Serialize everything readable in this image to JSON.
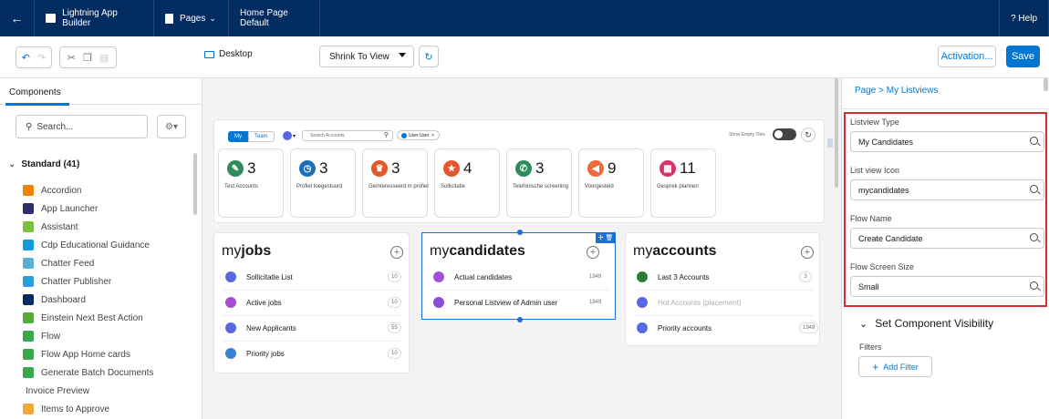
{
  "topbar": {
    "back": "←",
    "app_name": "Lightning App Builder",
    "pages_menu": "Pages",
    "page_name": "Home Page Default",
    "help": "? Help"
  },
  "toolbar": {
    "device": "Desktop",
    "view_mode": "Shrink To View",
    "activation": "Activation...",
    "save": "Save"
  },
  "left_panel": {
    "tab": "Components",
    "search_placeholder": "Search...",
    "section": "Standard (41)",
    "items": [
      {
        "label": "Accordion",
        "color": "#f38303"
      },
      {
        "label": "App Launcher",
        "color": "#2e2e6b"
      },
      {
        "label": "Assistant",
        "color": "#7fbf3f"
      },
      {
        "label": "Cdp Educational Guidance",
        "color": "#0d9dda"
      },
      {
        "label": "Chatter Feed",
        "color": "#5ab0d2"
      },
      {
        "label": "Chatter Publisher",
        "color": "#2d9ddc"
      },
      {
        "label": "Dashboard",
        "color": "#032d60"
      },
      {
        "label": "Einstein Next Best Action",
        "color": "#58a935"
      },
      {
        "label": "Flow",
        "color": "#3ca64a"
      },
      {
        "label": "Flow App Home cards",
        "color": "#3ca64a"
      },
      {
        "label": "Generate Batch Documents",
        "color": "#3ca64a"
      },
      {
        "label": "Invoice Preview",
        "color": ""
      },
      {
        "label": "Items to Approve",
        "color": "#f2a93b"
      }
    ]
  },
  "canvas": {
    "filter_bar": {
      "my": "My",
      "team": "Team",
      "search_placeholder": "Search Accounts",
      "user_chip": "User User",
      "show_empty": "Show Empty Tiles"
    },
    "tiles": [
      {
        "num": "3",
        "label": "Test Accounts",
        "color": "#2e8c5b",
        "icon": "✎"
      },
      {
        "num": "3",
        "label": "Profiel toegestuurd",
        "color": "#1f6fb8",
        "icon": "◷"
      },
      {
        "num": "3",
        "label": "Geïnteresseerd in profiel",
        "color": "#e4572e",
        "icon": "♛"
      },
      {
        "num": "4",
        "label": "Sollicitatie",
        "color": "#e4572e",
        "icon": "★"
      },
      {
        "num": "3",
        "label": "Telefonische screening",
        "color": "#2e8c5b",
        "icon": "✆"
      },
      {
        "num": "9",
        "label": "Voorgesteld",
        "color": "#ee6a3a",
        "icon": "◀"
      },
      {
        "num": "11",
        "label": "Gesprek plannen",
        "color": "#d6336c",
        "icon": "▦"
      }
    ],
    "lists": [
      {
        "title_prefix": "my",
        "title_bold": "jobs",
        "rows": [
          {
            "label": "Sollicitatie List",
            "count": "10",
            "color": "#5867e8",
            "faded": false
          },
          {
            "label": "Active jobs",
            "count": "10",
            "color": "#a34ed6",
            "faded": false
          },
          {
            "label": "New Applicants",
            "count": "55",
            "color": "#5867e8",
            "faded": false
          },
          {
            "label": "Priority jobs",
            "count": "10",
            "color": "#3b82d1",
            "faded": false
          }
        ]
      },
      {
        "title_prefix": "my",
        "title_bold": "candidates",
        "rows": [
          {
            "label": "Actual candidates",
            "count": "1949",
            "color": "#a34ed6",
            "faded": false
          },
          {
            "label": "Personal Listview of Admin user",
            "count": "1949",
            "color": "#8a4fd6",
            "faded": false
          }
        ]
      },
      {
        "title_prefix": "my",
        "title_bold": "accounts",
        "rows": [
          {
            "label": "Last 3 Accounts",
            "count": "3",
            "color": "#2e7d32",
            "faded": false
          },
          {
            "label": "Hot Accounts (placement)",
            "count": "",
            "color": "#5867e8",
            "faded": true
          },
          {
            "label": "Priority accounts",
            "count": "1949",
            "color": "#5867e8",
            "faded": false
          }
        ]
      }
    ]
  },
  "right_panel": {
    "breadcrumb": "Page  >  My Listviews",
    "fields": [
      {
        "label": "Listview Type",
        "value": "My Candidates"
      },
      {
        "label": "List view Icon",
        "value": "mycandidates"
      },
      {
        "label": "Flow Name",
        "value": "Create Candidate"
      },
      {
        "label": "Flow Screen Size",
        "value": "Small"
      }
    ],
    "visibility_title": "Set Component Visibility",
    "filters_label": "Filters",
    "add_filter": "Add Filter"
  }
}
